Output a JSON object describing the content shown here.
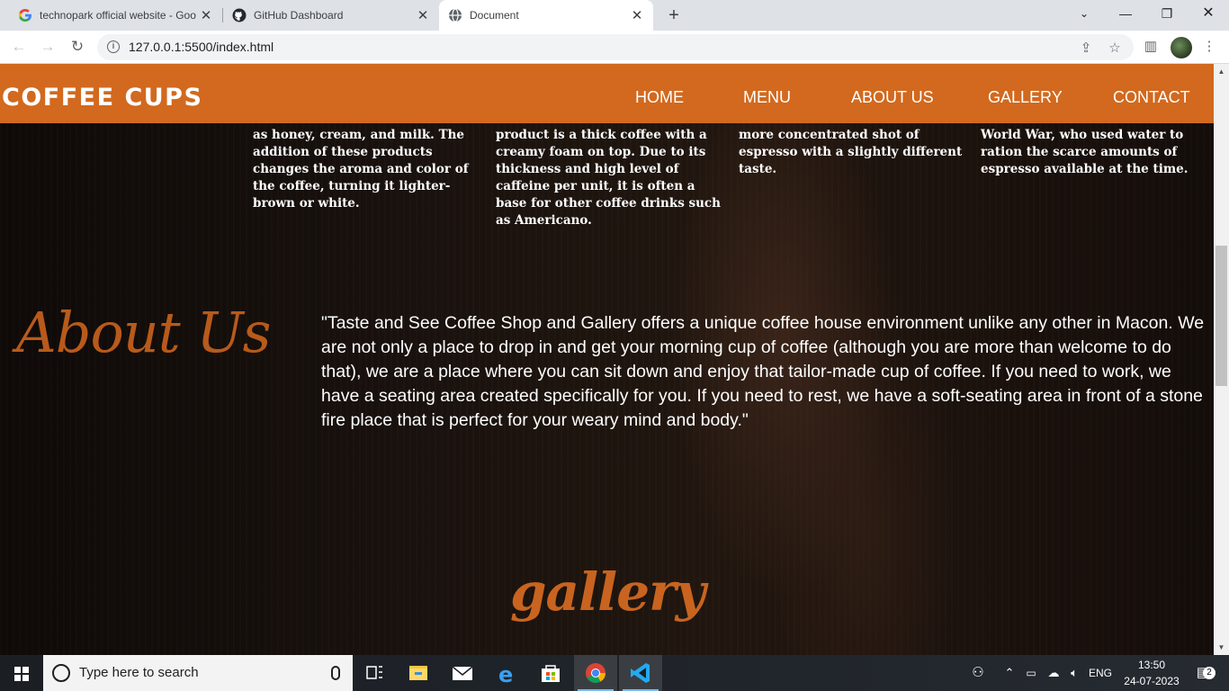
{
  "browser": {
    "tabs": [
      {
        "title": "technopark official website - Goo",
        "icon": "google-icon",
        "active": false
      },
      {
        "title": "GitHub Dashboard",
        "icon": "github-icon",
        "active": false
      },
      {
        "title": "Document",
        "icon": "globe-icon",
        "active": true
      }
    ],
    "url": "127.0.0.1:5500/index.html"
  },
  "site": {
    "brand": "COFFEE CUPS",
    "nav": [
      "HOME",
      "MENU",
      "ABOUT US",
      "GALLERY",
      "CONTACT"
    ]
  },
  "coffees": [
    {
      "desc": "as honey, cream, and milk. The addition of these products changes the aroma and color of the coffee, turning it lighter-brown or white."
    },
    {
      "desc": "product is a thick coffee with a creamy foam on top. Due to its thickness and high level of caffeine per unit, it is often a base for other coffee drinks such as Americano."
    },
    {
      "desc": "more concentrated shot of espresso with a slightly different taste."
    },
    {
      "desc": "World War, who used water to ration the scarce amounts of espresso available at the time."
    }
  ],
  "about": {
    "heading": "About Us",
    "text": "\"Taste and See Coffee Shop and Gallery offers a unique coffee house environment unlike any other in Macon. We are not only a place to drop in and get your morning cup of coffee (although you are more than welcome to do that), we are a place where you can sit down and enjoy that tailor-made cup of coffee. If you need to work, we have a seating area created specifically for you. If you need to rest, we have a soft-seating area in front of a stone fire place that is perfect for your weary mind and body.\""
  },
  "gallery": {
    "heading": "gallery"
  },
  "taskbar": {
    "search_placeholder": "Type here to search",
    "language": "ENG",
    "time": "13:50",
    "date": "24-07-2023",
    "notification_count": "2"
  }
}
